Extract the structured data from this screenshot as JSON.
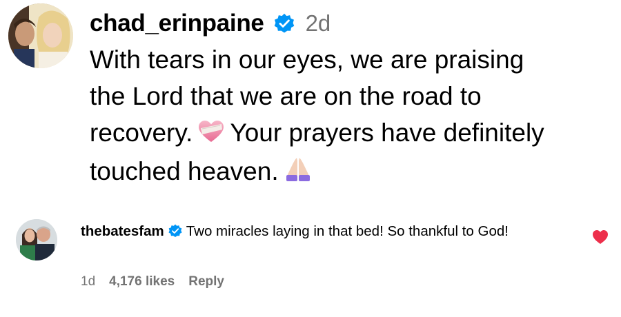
{
  "post": {
    "username": "chad_erinpaine",
    "time": "2d",
    "lines": [
      "With tears in our eyes, we are praising",
      "the Lord that we are on the road to",
      "recovery.",
      "Your prayers have definitely",
      "touched heaven."
    ],
    "emojis": [
      "heart-with-bandage",
      "folded-hands"
    ]
  },
  "reply": {
    "username": "thebatesfam",
    "text": "Two miracles laying in that bed! So thankful to God!",
    "time": "1d",
    "likes": "4,176 likes",
    "reply_label": "Reply",
    "liked": true
  },
  "colors": {
    "verified": "#0095f6",
    "heart": "#ed2f4b",
    "secondary_text": "#737373"
  }
}
